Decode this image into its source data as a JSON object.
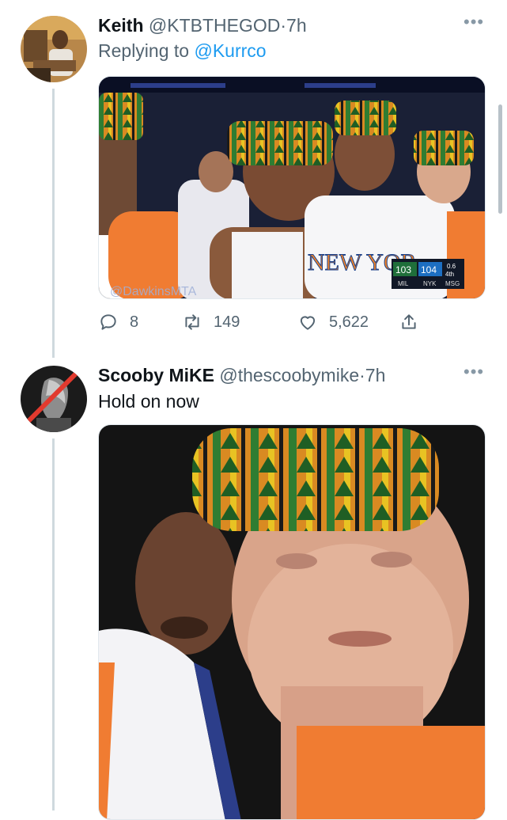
{
  "tweets": [
    {
      "display_name": "Keith",
      "handle": "@KTBTHEGOD",
      "separator": "·",
      "time": "7h",
      "replying_prefix": "Replying to",
      "replying_to": "@Kurrco",
      "media": {
        "jersey_text": "NEW YOR",
        "watermark": "@DawkinsMTA",
        "scorebug": {
          "away_score": "103",
          "home_score": "104",
          "period": "4th",
          "clock": "0.6",
          "away_team": "MIL",
          "home_team": "NYK",
          "network": "MSG"
        }
      },
      "actions": {
        "replies": "8",
        "retweets": "149",
        "likes": "5,622"
      }
    },
    {
      "display_name": "Scooby MiKE",
      "handle": "@thescoobymike",
      "separator": "·",
      "time": "7h",
      "text": "Hold on now"
    }
  ],
  "colors": {
    "accent": "#1d9bf0",
    "secondary_text": "#536471",
    "thread_line": "#cfd9de",
    "knicks_orange": "#f58426"
  },
  "icons": [
    "reply-icon",
    "retweet-icon",
    "like-icon",
    "share-icon",
    "more-icon"
  ]
}
